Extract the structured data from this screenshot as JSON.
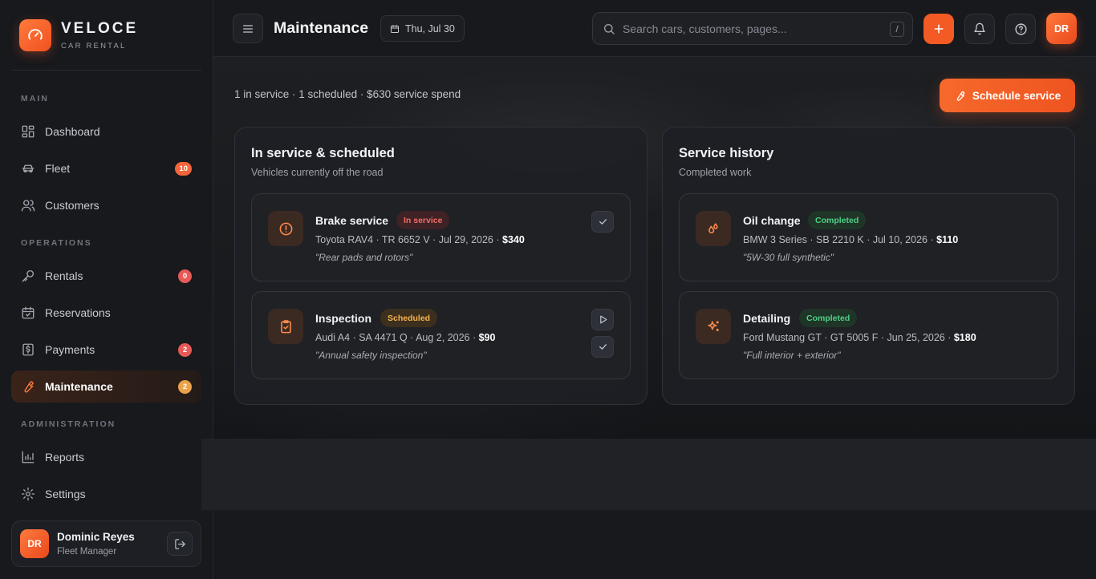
{
  "brand": {
    "name": "VELOCE",
    "subtitle": "CAR RENTAL"
  },
  "sidebar": {
    "sections": {
      "main": "MAIN",
      "operations": "OPERATIONS",
      "administration": "ADMINISTRATION"
    },
    "items": [
      {
        "label": "Dashboard",
        "icon": "dashboard-icon"
      },
      {
        "label": "Fleet",
        "icon": "car-icon",
        "badge": "10"
      },
      {
        "label": "Customers",
        "icon": "users-icon"
      },
      {
        "label": "Rentals",
        "icon": "key-icon",
        "badge": "0"
      },
      {
        "label": "Reservations",
        "icon": "calendar-check-icon"
      },
      {
        "label": "Payments",
        "icon": "receipt-icon",
        "badge": "2"
      },
      {
        "label": "Maintenance",
        "icon": "wrench-icon",
        "badge": "2",
        "active": true
      },
      {
        "label": "Reports",
        "icon": "bar-chart-icon"
      },
      {
        "label": "Settings",
        "icon": "gear-icon"
      }
    ],
    "badge_colors": {
      "fleet": "#f4663a",
      "rentals": "#e85a57",
      "payments": "#e85a57",
      "maintenance": "#eba24a"
    }
  },
  "user": {
    "initials": "DR",
    "name": "Dominic Reyes",
    "role": "Fleet Manager"
  },
  "header": {
    "title": "Maintenance",
    "date": "Thu, Jul 30",
    "search_placeholder": "Search cars, customers, pages...",
    "search_shortcut": "/",
    "avatar_initials": "DR"
  },
  "main": {
    "summary": "1 in service · 1 scheduled · $630 service spend",
    "schedule_button": "Schedule service",
    "accent_color": "#f35a24"
  },
  "in_service_panel": {
    "title": "In service & scheduled",
    "subtitle": "Vehicles currently off the road",
    "items": [
      {
        "title": "Brake service",
        "status": "In service",
        "meta": "Toyota RAV4 · TR 6652 V · Jul 29, 2026 · ",
        "cost": "$340",
        "note": "\"Rear pads and rotors\"",
        "icon": "alert-circle-icon"
      },
      {
        "title": "Inspection",
        "status": "Scheduled",
        "meta": "Audi A4 · SA 4471 Q · Aug 2, 2026 · ",
        "cost": "$90",
        "note": "\"Annual safety inspection\"",
        "icon": "clipboard-check-icon"
      }
    ]
  },
  "history_panel": {
    "title": "Service history",
    "subtitle": "Completed work",
    "items": [
      {
        "title": "Oil change",
        "status": "Completed",
        "meta": "BMW 3 Series · SB 2210 K · Jul 10, 2026 · ",
        "cost": "$110",
        "note": "\"5W-30 full synthetic\"",
        "icon": "droplets-icon"
      },
      {
        "title": "Detailing",
        "status": "Completed",
        "meta": "Ford Mustang GT · GT 5005 F · Jun 25, 2026 · ",
        "cost": "$180",
        "note": "\"Full interior + exterior\"",
        "icon": "sparkles-icon"
      }
    ]
  }
}
